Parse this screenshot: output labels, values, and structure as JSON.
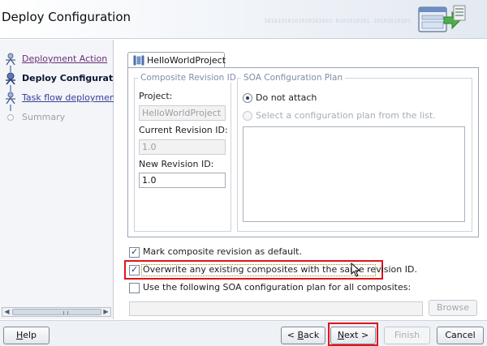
{
  "header": {
    "title": "Deploy Configuration",
    "decor_text": "10101010101010101001 0101010101 10101010101010101010",
    "icon": "deploy-wizard-icon"
  },
  "nav": {
    "items": [
      {
        "label": "Deployment Action",
        "state": "visited",
        "icon": "step-done-icon"
      },
      {
        "label": "Deploy Configuration",
        "state": "current",
        "icon": "step-current-icon"
      },
      {
        "label": "Task flow deployment",
        "state": "link",
        "icon": "step-link-icon"
      },
      {
        "label": "Summary",
        "state": "disabled",
        "icon": "step-pending-icon"
      }
    ]
  },
  "tab": {
    "label": "HelloWorldProject",
    "icon": "composite-project-icon"
  },
  "composite_revision": {
    "title": "Composite Revision ID",
    "project_label": "Project:",
    "project_value": "HelloWorldProject",
    "current_label": "Current Revision ID:",
    "current_value": "1.0",
    "new_label": "New Revision ID:",
    "new_value": "1.0"
  },
  "soa_plan": {
    "title": "SOA Configuration Plan",
    "option_do_not_attach": "Do not attach",
    "option_select_plan": "Select a configuration plan from the list.",
    "selected": "Do not attach"
  },
  "options": {
    "mark_default": {
      "label": "Mark composite revision as default.",
      "checked": true
    },
    "overwrite": {
      "label": "Overwrite any existing composites with the same revision ID.",
      "checked": true
    },
    "use_plan": {
      "label": "Use the following SOA configuration plan for all composites:",
      "checked": false
    },
    "plan_path_value": "",
    "browse_label": "Browse"
  },
  "footer": {
    "help": {
      "prefix": "",
      "mnemonic": "H",
      "suffix": "elp"
    },
    "back": {
      "prefix": "< ",
      "mnemonic": "B",
      "suffix": "ack"
    },
    "next": {
      "prefix": "",
      "mnemonic": "N",
      "suffix": "ext >"
    },
    "finish": "Finish",
    "cancel": "Cancel"
  },
  "colors": {
    "highlight": "#e0141d",
    "link": "#3a3d99",
    "group_title": "#7d8fa8"
  }
}
